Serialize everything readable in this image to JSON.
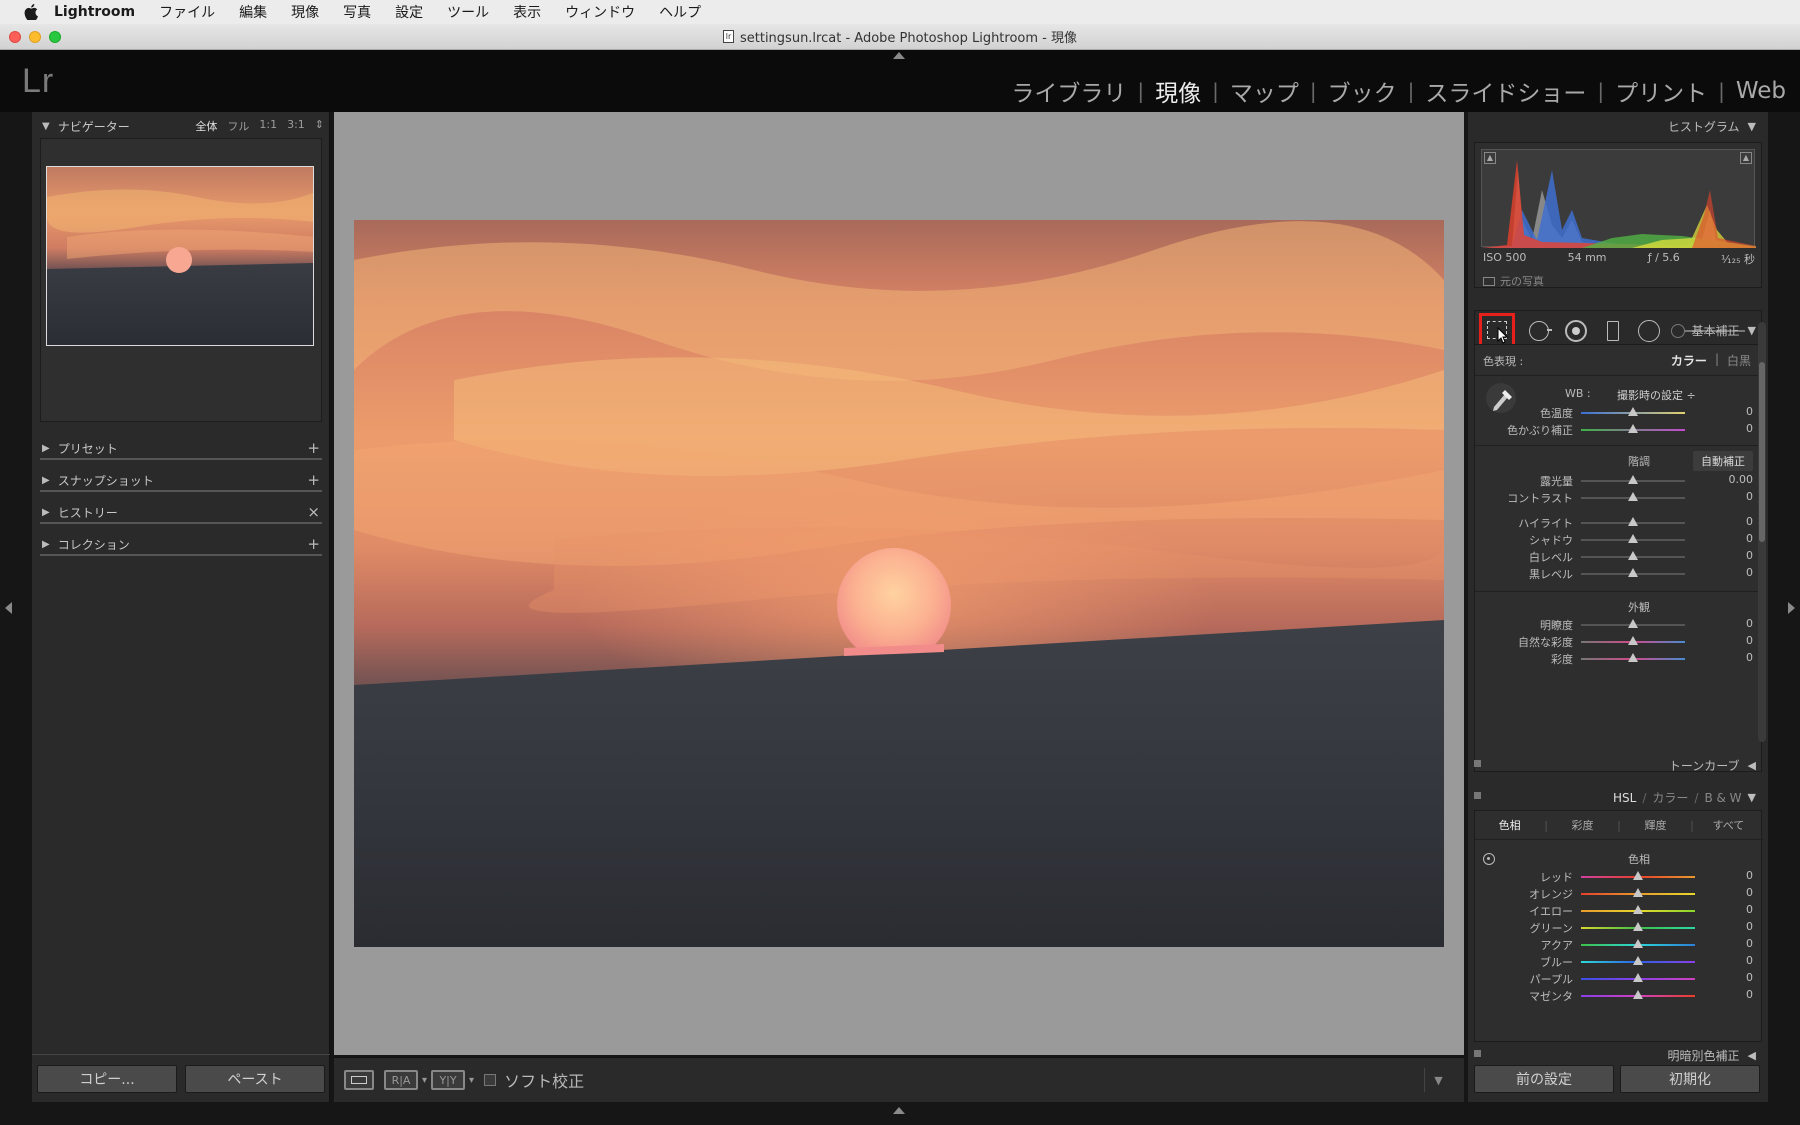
{
  "menubar": {
    "app": "Lightroom",
    "items": [
      "ファイル",
      "編集",
      "現像",
      "写真",
      "設定",
      "ツール",
      "表示",
      "ウィンドウ",
      "ヘルプ"
    ]
  },
  "window": {
    "title": "settingsun.lrcat - Adobe Photoshop Lightroom - 現像"
  },
  "header": {
    "logo": "Lr",
    "modules": [
      "ライブラリ",
      "現像",
      "マップ",
      "ブック",
      "スライドショー",
      "プリント",
      "Web"
    ],
    "active_module": "現像",
    "separator": "|"
  },
  "left_panel": {
    "navigator": {
      "title": "ナビゲーター",
      "zoom_options": [
        "全体",
        "フル",
        "1:1",
        "3:1"
      ],
      "zoom_selected": "全体"
    },
    "sections": [
      {
        "label": "プリセット",
        "action": "+"
      },
      {
        "label": "スナップショット",
        "action": "+"
      },
      {
        "label": "ヒストリー",
        "action": "×"
      },
      {
        "label": "コレクション",
        "action": "+"
      }
    ],
    "copy_button": "コピー...",
    "paste_button": "ペースト"
  },
  "toolbar": {
    "soft_proof_label": "ソフト校正",
    "view_ra": "R|A",
    "view_yy": "Y|Y"
  },
  "right_panel": {
    "histogram": {
      "title": "ヒストグラム",
      "iso": "ISO 500",
      "focal": "54 mm",
      "aperture": "ƒ / 5.6",
      "shutter": "¹⁄₁₂₅ 秒",
      "original_photo": "元の写真"
    },
    "basic": {
      "title": "基本補正",
      "treatment_label": "色表現 :",
      "color": "カラー",
      "bw": "白黒",
      "wb_label": "WB :",
      "wb_value": "撮影時の設定 ÷",
      "tone_label": "階調",
      "auto": "自動補正",
      "presence_label": "外観",
      "sliders_wb": [
        {
          "label": "色温度",
          "value": "0",
          "position": 0.5
        },
        {
          "label": "色かぶり補正",
          "value": "0",
          "position": 0.5
        }
      ],
      "sliders_tone1": [
        {
          "label": "露光量",
          "value": "0.00",
          "position": 0.5
        },
        {
          "label": "コントラスト",
          "value": "0",
          "position": 0.5
        }
      ],
      "sliders_tone2": [
        {
          "label": "ハイライト",
          "value": "0",
          "position": 0.5
        },
        {
          "label": "シャドウ",
          "value": "0",
          "position": 0.5
        },
        {
          "label": "白レベル",
          "value": "0",
          "position": 0.5
        },
        {
          "label": "黒レベル",
          "value": "0",
          "position": 0.5
        }
      ],
      "sliders_presence": [
        {
          "label": "明瞭度",
          "value": "0",
          "position": 0.5
        },
        {
          "label": "自然な彩度",
          "value": "0",
          "position": 0.5
        },
        {
          "label": "彩度",
          "value": "0",
          "position": 0.5
        }
      ]
    },
    "tone_curve": {
      "title": "トーンカーブ"
    },
    "hsl": {
      "title_hsl": "HSL",
      "title_color": "カラー",
      "title_bw": "B & W",
      "slash": "/",
      "tabs": [
        "色相",
        "彩度",
        "輝度",
        "すべて"
      ],
      "active_tab": "色相",
      "section": "色相",
      "sliders": [
        {
          "label": "レッド",
          "value": "0",
          "position": 0.5
        },
        {
          "label": "オレンジ",
          "value": "0",
          "position": 0.5
        },
        {
          "label": "イエロー",
          "value": "0",
          "position": 0.5
        },
        {
          "label": "グリーン",
          "value": "0",
          "position": 0.5
        },
        {
          "label": "アクア",
          "value": "0",
          "position": 0.5
        },
        {
          "label": "ブルー",
          "value": "0",
          "position": 0.5
        },
        {
          "label": "パープル",
          "value": "0",
          "position": 0.5
        },
        {
          "label": "マゼンタ",
          "value": "0",
          "position": 0.5
        }
      ]
    },
    "split_toning": {
      "title": "明暗別色補正"
    },
    "previous_button": "前の設定",
    "reset_button": "初期化"
  },
  "colors": {
    "highlight": "#e8201b",
    "active_text": "#ececec"
  }
}
